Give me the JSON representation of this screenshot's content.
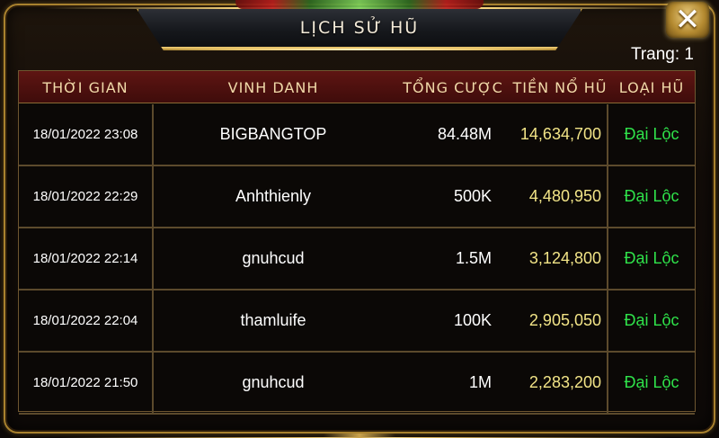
{
  "dialog": {
    "title": "LỊCH SỬ HŨ",
    "close_label": "✕",
    "page_label": "Trang: 1"
  },
  "table": {
    "headers": {
      "time": "THỜI GIAN",
      "name": "VINH DANH",
      "bet": "TỔNG CƯỢC",
      "jackpot": "TIỀN NỔ HŨ",
      "type": "LOẠI HŨ"
    },
    "rows": [
      {
        "time": "18/01/2022 23:08",
        "name": "BIGBANGTOP",
        "bet": "84.48M",
        "jackpot": "14,634,700",
        "type": "Đại Lộc"
      },
      {
        "time": "18/01/2022 22:29",
        "name": "Anhthienly",
        "bet": "500K",
        "jackpot": "4,480,950",
        "type": "Đại Lộc"
      },
      {
        "time": "18/01/2022 22:14",
        "name": "gnuhcud",
        "bet": "1.5M",
        "jackpot": "3,124,800",
        "type": "Đại Lộc"
      },
      {
        "time": "18/01/2022 22:04",
        "name": "thamluife",
        "bet": "100K",
        "jackpot": "2,905,050",
        "type": "Đại Lộc"
      },
      {
        "time": "18/01/2022 21:50",
        "name": "gnuhcud",
        "bet": "1M",
        "jackpot": "2,283,200",
        "type": "Đại Lộc"
      }
    ]
  },
  "colors": {
    "gold_border": "#a8812e",
    "header_bg": "#5e1512",
    "jackpot_text": "#f2e487",
    "type_text": "#2fe24a"
  }
}
